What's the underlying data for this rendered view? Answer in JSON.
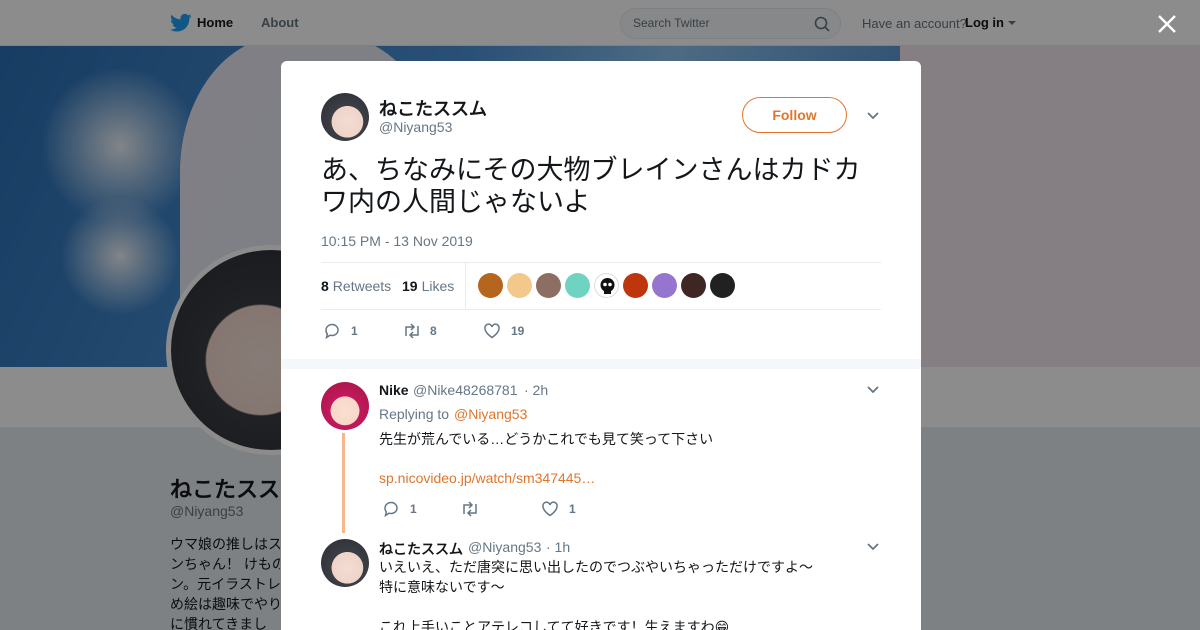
{
  "nav": {
    "home": "Home",
    "about": "About",
    "search_placeholder": "Search Twitter",
    "have_account": "Have an account?",
    "login": "Log in"
  },
  "background_profile": {
    "name": "ねこたススム",
    "handle": "@Niyang53",
    "bio_lines": [
      "ウマ娘の推しはス",
      "ンちゃん！ けもの",
      "ン。元イラストレ",
      "め絵は趣味でやり",
      "に慣れてきまし"
    ]
  },
  "tweet": {
    "author_name": "ねこたススム",
    "author_handle": "@Niyang53",
    "follow_label": "Follow",
    "text": "あ、ちなみにその大物ブレインさんはカドカワ内の人間じゃないよ",
    "timestamp": "10:15 PM - 13 Nov 2019",
    "retweets_count": "8",
    "retweets_label": "Retweets",
    "likes_count": "19",
    "likes_label": "Likes",
    "actions": {
      "replies": "1",
      "retweets": "8",
      "likes": "19"
    }
  },
  "replies": [
    {
      "name": "Nike",
      "handle": "@Nike48268781",
      "time": "· 2h",
      "replying_prefix": "Replying to",
      "replying_to": "@Niyang53",
      "text": "先生が荒んでいる…どうかこれでも見て笑って下さい",
      "link": "sp.nicovideo.jp/watch/sm347445…",
      "actions": {
        "replies": "1",
        "likes": "1"
      }
    },
    {
      "name": "ねこたススム",
      "handle": "@Niyang53",
      "time": "· 1h",
      "line1": "いえいえ、ただ唐突に思い出したのでつぶやいちゃっただけですよ～",
      "line2": "特に意味ないです～",
      "line3": "これ上手いことアテレコしてて好きです！生えますわ😁"
    }
  ],
  "colors": {
    "accent": "#e0762c",
    "twitter_blue": "#1da1f2",
    "thread_line": "#f6b78a"
  }
}
